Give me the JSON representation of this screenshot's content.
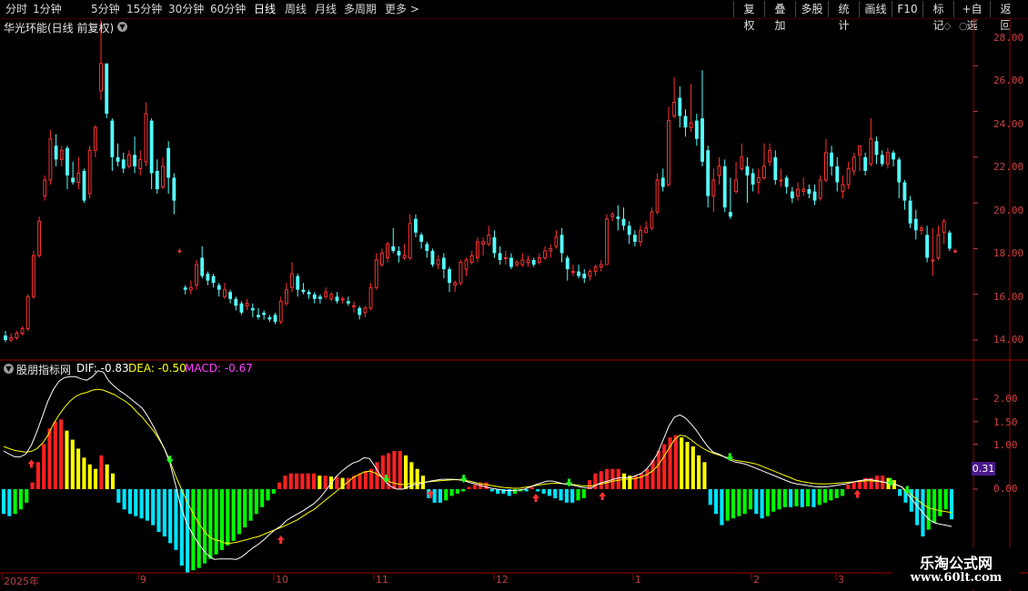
{
  "toolbar": {
    "periods": [
      "分时",
      "1分钟",
      "5分钟",
      "15分钟",
      "30分钟",
      "60分钟",
      "日线",
      "周线",
      "月线",
      "多周期",
      "更多 >"
    ],
    "active_period": "日线",
    "right_buttons": [
      "复权",
      "叠加",
      "多股",
      "统计",
      "画线",
      "F10",
      "标记",
      "+自选",
      "返回"
    ]
  },
  "price_panel": {
    "title": "华光环能(日线 前复权)",
    "y_ticks": [
      "28.00",
      "26.00",
      "24.00",
      "22.00",
      "20.00",
      "18.00",
      "16.00",
      "14.00"
    ]
  },
  "indicator_panel": {
    "name": "股朋指标网",
    "dif_text": "DIF: -0.83",
    "dea_text": "DEA: -0.50",
    "macd_text": "MACD: -0.67",
    "y_ticks": [
      "2.00",
      "1.50",
      "1.00",
      "0.00"
    ],
    "current_value": "0.31"
  },
  "x_axis": {
    "labels": [
      "2025年",
      "9",
      "10",
      "11",
      "12",
      "1",
      "2",
      "3"
    ]
  },
  "watermark": {
    "line1": "乐淘公式网",
    "line2": "www.60lt.com"
  },
  "colors": {
    "up": "#ff3232",
    "down": "#54ffff",
    "dif": "#ffffff",
    "dea": "#ffff00",
    "macd_label": "#ff00ff",
    "hist_red": "#ff2020",
    "hist_yellow": "#ffff00",
    "hist_cyan": "#00e5ff",
    "hist_green": "#00ff00",
    "grid_red": "#8b0000"
  },
  "chart_data": {
    "type": "candlestick",
    "price_ylim": [
      13.0,
      29.0
    ],
    "candles": [
      [
        14.2,
        14.0,
        14.4,
        13.9
      ],
      [
        14.0,
        14.1,
        14.3,
        13.9
      ],
      [
        14.1,
        14.3,
        14.4,
        14.0
      ],
      [
        14.3,
        14.5,
        14.6,
        14.2
      ],
      [
        14.5,
        15.9,
        16.0,
        14.4
      ],
      [
        15.9,
        17.7,
        17.9,
        15.8
      ],
      [
        17.7,
        19.2,
        19.4,
        17.6
      ],
      [
        20.3,
        21.0,
        21.2,
        20.1
      ],
      [
        21.0,
        22.8,
        23.2,
        20.8
      ],
      [
        22.5,
        21.9,
        23.0,
        21.6
      ],
      [
        21.9,
        22.3,
        22.5,
        21.6
      ],
      [
        22.4,
        21.2,
        22.5,
        20.6
      ],
      [
        21.1,
        20.9,
        21.8,
        20.8
      ],
      [
        20.9,
        21.3,
        22.0,
        20.6
      ],
      [
        21.4,
        20.1,
        21.5,
        20.0
      ],
      [
        20.4,
        22.3,
        22.5,
        20.2
      ],
      [
        22.3,
        23.3,
        23.4,
        22.0
      ],
      [
        24.9,
        26.1,
        28.0,
        24.5
      ],
      [
        26.1,
        23.9,
        26.1,
        23.7
      ],
      [
        23.6,
        22.0,
        23.7,
        21.4
      ],
      [
        22.0,
        21.8,
        22.6,
        21.6
      ],
      [
        21.9,
        21.5,
        22.2,
        21.3
      ],
      [
        21.6,
        22.1,
        22.3,
        21.5
      ],
      [
        22.1,
        21.6,
        22.9,
        21.3
      ],
      [
        21.5,
        21.9,
        22.3,
        21.2
      ],
      [
        21.8,
        23.9,
        24.4,
        21.6
      ],
      [
        23.6,
        21.3,
        23.7,
        20.6
      ],
      [
        21.4,
        20.6,
        21.9,
        20.4
      ],
      [
        20.7,
        21.6,
        22.0,
        20.6
      ],
      [
        22.4,
        21.1,
        22.7,
        20.4
      ],
      [
        21.1,
        20.1,
        21.3,
        19.5
      ],
      [
        17.9,
        17.9,
        18.0,
        17.8
      ],
      [
        16.3,
        16.2,
        16.4,
        16.0
      ],
      [
        16.2,
        16.3,
        16.6,
        16.0
      ],
      [
        16.4,
        17.3,
        17.5,
        16.2
      ],
      [
        17.6,
        16.8,
        18.1,
        16.7
      ],
      [
        16.9,
        16.6,
        17.0,
        16.4
      ],
      [
        16.8,
        16.5,
        16.9,
        16.3
      ],
      [
        16.4,
        16.2,
        16.5,
        15.9
      ],
      [
        15.9,
        16.2,
        16.5,
        15.8
      ],
      [
        16.1,
        15.8,
        16.2,
        15.6
      ],
      [
        15.8,
        15.5,
        15.9,
        15.3
      ],
      [
        15.6,
        15.2,
        15.7,
        15.1
      ],
      [
        15.5,
        15.6,
        15.8,
        15.3
      ],
      [
        15.4,
        15.3,
        15.6,
        15.0
      ],
      [
        15.1,
        15.0,
        15.4,
        14.9
      ],
      [
        15.2,
        15.1,
        15.3,
        14.9
      ],
      [
        15.0,
        14.9,
        15.1,
        14.8
      ],
      [
        15.1,
        14.8,
        15.2,
        14.7
      ],
      [
        14.8,
        15.7,
        15.9,
        14.7
      ],
      [
        15.6,
        16.2,
        16.5,
        15.5
      ],
      [
        16.3,
        16.9,
        17.4,
        16.1
      ],
      [
        16.8,
        16.2,
        16.9,
        15.9
      ],
      [
        16.2,
        16.1,
        16.5,
        16.0
      ],
      [
        16.1,
        16.0,
        16.2,
        15.8
      ],
      [
        16.0,
        15.8,
        16.1,
        15.6
      ],
      [
        15.9,
        15.8,
        16.0,
        15.6
      ],
      [
        15.9,
        16.1,
        16.3,
        15.8
      ],
      [
        15.8,
        16.0,
        16.1,
        15.7
      ],
      [
        15.9,
        15.7,
        16.1,
        15.6
      ],
      [
        15.8,
        15.8,
        15.9,
        15.6
      ],
      [
        15.7,
        15.6,
        15.9,
        15.5
      ],
      [
        15.5,
        15.5,
        15.7,
        15.2
      ],
      [
        15.4,
        15.1,
        15.5,
        14.9
      ],
      [
        15.2,
        15.4,
        15.5,
        15.0
      ],
      [
        15.4,
        16.3,
        16.5,
        15.3
      ],
      [
        16.3,
        17.5,
        17.8,
        16.2
      ],
      [
        17.3,
        17.8,
        18.0,
        17.2
      ],
      [
        17.6,
        18.2,
        18.3,
        17.4
      ],
      [
        18.1,
        17.9,
        18.9,
        17.8
      ],
      [
        17.9,
        17.7,
        18.1,
        17.4
      ],
      [
        17.6,
        17.7,
        18.2,
        17.5
      ],
      [
        17.6,
        19.1,
        19.5,
        17.5
      ],
      [
        19.3,
        18.7,
        19.5,
        18.5
      ],
      [
        18.6,
        18.3,
        18.7,
        18.0
      ],
      [
        18.2,
        17.9,
        18.3,
        17.6
      ],
      [
        17.9,
        17.3,
        18.0,
        17.2
      ],
      [
        17.3,
        17.5,
        17.7,
        17.1
      ],
      [
        17.6,
        17.1,
        17.8,
        16.7
      ],
      [
        17.1,
        16.5,
        17.2,
        16.1
      ],
      [
        16.4,
        16.5,
        16.6,
        16.1
      ],
      [
        16.5,
        17.4,
        17.5,
        16.4
      ],
      [
        17.1,
        17.5,
        17.6,
        16.8
      ],
      [
        17.4,
        17.7,
        17.9,
        17.3
      ],
      [
        17.6,
        18.3,
        18.5,
        17.4
      ],
      [
        18.2,
        18.3,
        18.5,
        17.7
      ],
      [
        18.2,
        18.6,
        19.0,
        18.1
      ],
      [
        18.5,
        17.8,
        18.8,
        17.6
      ],
      [
        17.8,
        17.5,
        18.1,
        17.3
      ],
      [
        17.6,
        17.6,
        17.9,
        17.3
      ],
      [
        17.6,
        17.2,
        17.8,
        17.1
      ],
      [
        17.3,
        17.4,
        17.5,
        17.2
      ],
      [
        17.3,
        17.5,
        17.8,
        17.2
      ],
      [
        17.4,
        17.5,
        17.7,
        17.2
      ],
      [
        17.5,
        17.3,
        17.6,
        17.2
      ],
      [
        17.4,
        17.6,
        17.8,
        17.3
      ],
      [
        17.6,
        17.9,
        18.1,
        17.5
      ],
      [
        17.9,
        18.0,
        18.2,
        17.6
      ],
      [
        18.1,
        18.5,
        18.8,
        18.0
      ],
      [
        18.6,
        17.8,
        18.9,
        17.4
      ],
      [
        17.6,
        17.1,
        17.7,
        16.6
      ],
      [
        17.0,
        17.0,
        17.3,
        16.8
      ],
      [
        17.0,
        16.8,
        17.3,
        16.7
      ],
      [
        16.9,
        16.7,
        17.1,
        16.5
      ],
      [
        16.8,
        17.0,
        17.1,
        16.6
      ],
      [
        17.0,
        17.2,
        17.3,
        16.8
      ],
      [
        17.2,
        17.3,
        17.5,
        17.0
      ],
      [
        17.3,
        19.3,
        19.5,
        17.3
      ],
      [
        19.4,
        19.5,
        19.6,
        19.2
      ],
      [
        19.4,
        19.3,
        19.9,
        18.8
      ],
      [
        19.3,
        19.0,
        19.8,
        18.8
      ],
      [
        19.0,
        18.6,
        19.2,
        18.2
      ],
      [
        18.6,
        18.3,
        18.8,
        18.1
      ],
      [
        18.3,
        18.8,
        19.0,
        18.1
      ],
      [
        18.7,
        18.9,
        19.2,
        18.7
      ],
      [
        18.9,
        19.6,
        19.8,
        18.8
      ],
      [
        19.6,
        21.0,
        21.3,
        19.5
      ],
      [
        21.1,
        20.7,
        21.5,
        20.5
      ],
      [
        20.8,
        23.6,
        24.2,
        20.7
      ],
      [
        23.8,
        24.4,
        25.5,
        23.7
      ],
      [
        24.6,
        23.8,
        25.1,
        23.3
      ],
      [
        23.8,
        23.3,
        24.1,
        22.9
      ],
      [
        23.3,
        23.5,
        25.2,
        23.1
      ],
      [
        23.6,
        22.8,
        23.9,
        22.5
      ],
      [
        23.7,
        21.8,
        25.8,
        21.6
      ],
      [
        22.3,
        20.3,
        22.5,
        19.8
      ],
      [
        20.3,
        21.0,
        21.5,
        19.6
      ],
      [
        21.2,
        21.6,
        22.0,
        20.8
      ],
      [
        21.6,
        19.8,
        21.9,
        19.6
      ],
      [
        19.6,
        19.4,
        21.1,
        19.3
      ],
      [
        20.5,
        21.0,
        21.8,
        20.4
      ],
      [
        21.5,
        22.0,
        22.6,
        21.4
      ],
      [
        21.6,
        21.2,
        22.0,
        20.0
      ],
      [
        21.3,
        20.8,
        21.5,
        20.5
      ],
      [
        20.9,
        21.1,
        21.5,
        20.4
      ],
      [
        21.1,
        21.6,
        22.6,
        21.0
      ],
      [
        21.8,
        22.3,
        22.6,
        21.6
      ],
      [
        22.0,
        21.0,
        22.3,
        20.8
      ],
      [
        21.0,
        21.0,
        21.5,
        20.7
      ],
      [
        21.1,
        20.7,
        21.2,
        20.4
      ],
      [
        20.5,
        20.2,
        20.7,
        20.0
      ],
      [
        20.3,
        20.6,
        20.9,
        20.1
      ],
      [
        20.5,
        20.6,
        21.1,
        20.3
      ],
      [
        20.6,
        20.4,
        20.8,
        20.2
      ],
      [
        20.5,
        20.1,
        20.8,
        19.9
      ],
      [
        20.2,
        21.0,
        21.2,
        20.1
      ],
      [
        21.0,
        22.2,
        22.8,
        20.9
      ],
      [
        22.2,
        21.6,
        22.5,
        21.2
      ],
      [
        21.6,
        20.9,
        22.0,
        20.5
      ],
      [
        20.5,
        20.8,
        21.2,
        20.2
      ],
      [
        20.8,
        21.5,
        21.8,
        20.6
      ],
      [
        21.4,
        22.0,
        22.2,
        21.2
      ],
      [
        22.1,
        22.5,
        22.5,
        21.4
      ],
      [
        22.0,
        21.4,
        22.2,
        21.2
      ],
      [
        21.7,
        22.8,
        23.7,
        21.6
      ],
      [
        22.7,
        22.1,
        22.9,
        21.7
      ],
      [
        22.1,
        21.7,
        22.3,
        21.6
      ],
      [
        21.7,
        22.2,
        22.4,
        21.5
      ],
      [
        22.2,
        21.9,
        22.3,
        21.6
      ],
      [
        21.9,
        20.9,
        22.0,
        20.2
      ],
      [
        20.9,
        20.1,
        21.0,
        19.7
      ],
      [
        20.1,
        19.1,
        20.3,
        18.9
      ],
      [
        19.3,
        18.8,
        19.7,
        18.4
      ],
      [
        18.8,
        18.9,
        19.0,
        18.6
      ],
      [
        18.6,
        17.6,
        19.0,
        17.4
      ],
      [
        17.5,
        17.5,
        18.9,
        16.8
      ],
      [
        17.6,
        18.6,
        19.0,
        17.5
      ],
      [
        18.7,
        19.2,
        19.3,
        18.2
      ],
      [
        18.7,
        18.0,
        18.8,
        17.9
      ],
      [
        17.9,
        17.9,
        18.0,
        17.8
      ]
    ],
    "dif": [
      0.85,
      0.78,
      0.72,
      0.72,
      0.78,
      0.98,
      1.28,
      1.62,
      1.96,
      2.22,
      2.4,
      2.48,
      2.5,
      2.5,
      2.45,
      2.42,
      2.5,
      2.63,
      2.6,
      2.4,
      2.28,
      2.18,
      2.1,
      2.0,
      1.9,
      1.8,
      1.62,
      1.4,
      1.15,
      0.9,
      0.58,
      0.1,
      -0.4,
      -0.75,
      -0.98,
      -1.18,
      -1.35,
      -1.48,
      -1.56,
      -1.55,
      -1.55,
      -1.55,
      -1.56,
      -1.5,
      -1.4,
      -1.3,
      -1.22,
      -1.12,
      -1.0,
      -0.9,
      -0.82,
      -0.7,
      -0.62,
      -0.55,
      -0.48,
      -0.4,
      -0.32,
      -0.2,
      -0.05,
      0.12,
      0.28,
      0.4,
      0.5,
      0.58,
      0.62,
      0.7,
      0.68,
      0.5,
      0.3,
      0.15,
      0.05,
      0.0,
      0.0,
      0.05,
      0.1,
      0.12,
      0.15,
      0.18,
      0.2,
      0.22,
      0.22,
      0.22,
      0.21,
      0.19,
      0.15,
      0.12,
      0.08,
      0.05,
      0.02,
      0.0,
      -0.02,
      -0.03,
      -0.03,
      -0.02,
      0.0,
      0.05,
      0.1,
      0.14,
      0.18,
      0.18,
      0.15,
      0.12,
      0.1,
      0.08,
      0.05,
      0.03,
      0.02,
      0.1,
      0.15,
      0.18,
      0.22,
      0.25,
      0.26,
      0.25,
      0.3,
      0.35,
      0.45,
      0.6,
      0.8,
      1.1,
      1.4,
      1.6,
      1.65,
      1.58,
      1.45,
      1.3,
      1.12,
      0.95,
      0.82,
      0.78,
      0.72,
      0.65,
      0.6,
      0.58,
      0.55,
      0.5,
      0.45,
      0.4,
      0.35,
      0.3,
      0.25,
      0.2,
      0.15,
      0.12,
      0.1,
      0.08,
      0.06,
      0.05,
      0.05,
      0.06,
      0.08,
      0.1,
      0.12,
      0.15,
      0.18,
      0.2,
      0.22,
      0.2,
      0.18,
      0.15,
      0.12,
      0.1,
      0.05,
      -0.1,
      -0.25,
      -0.4,
      -0.55,
      -0.68,
      -0.75,
      -0.78,
      -0.8,
      -0.83
    ],
    "dea": [
      0.95,
      0.9,
      0.86,
      0.84,
      0.82,
      0.84,
      0.9,
      1.02,
      1.2,
      1.45,
      1.65,
      1.82,
      1.96,
      2.06,
      2.12,
      2.15,
      2.2,
      2.22,
      2.2,
      2.15,
      2.1,
      2.02,
      1.95,
      1.85,
      1.72,
      1.6,
      1.45,
      1.3,
      1.12,
      0.9,
      0.62,
      0.3,
      0.02,
      -0.25,
      -0.5,
      -0.72,
      -0.9,
      -1.05,
      -1.12,
      -1.15,
      -1.2,
      -1.2,
      -1.18,
      -1.15,
      -1.12,
      -1.08,
      -1.05,
      -1.0,
      -0.95,
      -0.9,
      -0.85,
      -0.8,
      -0.74,
      -0.68,
      -0.6,
      -0.52,
      -0.45,
      -0.35,
      -0.25,
      -0.15,
      -0.05,
      0.05,
      0.15,
      0.25,
      0.32,
      0.38,
      0.4,
      0.36,
      0.28,
      0.2,
      0.15,
      0.12,
      0.1,
      0.12,
      0.14,
      0.15,
      0.16,
      0.17,
      0.18,
      0.19,
      0.2,
      0.21,
      0.21,
      0.2,
      0.18,
      0.15,
      0.12,
      0.1,
      0.08,
      0.06,
      0.04,
      0.03,
      0.02,
      0.02,
      0.04,
      0.06,
      0.08,
      0.1,
      0.12,
      0.13,
      0.13,
      0.12,
      0.11,
      0.1,
      0.08,
      0.07,
      0.07,
      0.1,
      0.12,
      0.15,
      0.18,
      0.2,
      0.22,
      0.22,
      0.24,
      0.27,
      0.32,
      0.4,
      0.52,
      0.7,
      0.9,
      1.1,
      1.2,
      1.18,
      1.1,
      1.0,
      0.92,
      0.85,
      0.8,
      0.76,
      0.72,
      0.68,
      0.64,
      0.62,
      0.6,
      0.58,
      0.55,
      0.5,
      0.45,
      0.4,
      0.35,
      0.3,
      0.25,
      0.2,
      0.17,
      0.15,
      0.13,
      0.12,
      0.12,
      0.12,
      0.13,
      0.14,
      0.15,
      0.16,
      0.17,
      0.18,
      0.19,
      0.18,
      0.17,
      0.15,
      0.13,
      0.1,
      0.05,
      -0.05,
      -0.15,
      -0.25,
      -0.35,
      -0.42,
      -0.45,
      -0.48,
      -0.5,
      -0.52
    ],
    "macd_hist": [
      -0.55,
      -0.6,
      -0.55,
      -0.45,
      -0.3,
      0.15,
      0.6,
      1.0,
      1.35,
      1.5,
      1.55,
      1.3,
      1.1,
      0.9,
      0.7,
      0.55,
      0.45,
      0.75,
      0.55,
      0.35,
      -0.3,
      -0.45,
      -0.55,
      -0.6,
      -0.65,
      -0.7,
      -0.8,
      -0.95,
      -1.05,
      -1.2,
      -1.35,
      -1.7,
      -1.85,
      -1.8,
      -1.75,
      -1.65,
      -1.55,
      -1.45,
      -1.35,
      -1.25,
      -1.15,
      -1.0,
      -0.85,
      -0.7,
      -0.55,
      -0.4,
      -0.25,
      -0.1,
      0.15,
      0.3,
      0.35,
      0.35,
      0.35,
      0.35,
      0.35,
      0.3,
      0.3,
      0.28,
      0.28,
      0.25,
      0.25,
      0.3,
      0.35,
      0.4,
      0.45,
      0.6,
      0.75,
      0.8,
      0.85,
      0.85,
      0.75,
      0.6,
      0.45,
      0.3,
      -0.2,
      -0.3,
      -0.3,
      -0.25,
      -0.15,
      -0.1,
      -0.05,
      0.05,
      0.1,
      0.15,
      0.15,
      -0.05,
      -0.1,
      -0.1,
      -0.15,
      -0.1,
      -0.05,
      -0.05,
      0.05,
      -0.05,
      -0.1,
      -0.15,
      -0.2,
      -0.25,
      -0.3,
      -0.3,
      -0.25,
      -0.2,
      0.2,
      0.35,
      0.4,
      0.45,
      0.45,
      0.45,
      0.35,
      0.3,
      0.3,
      0.35,
      0.45,
      0.65,
      0.85,
      1.0,
      1.15,
      1.2,
      1.15,
      1.05,
      0.95,
      0.75,
      0.6,
      -0.35,
      -0.55,
      -0.8,
      -0.7,
      -0.65,
      -0.6,
      -0.55,
      -0.45,
      -0.55,
      -0.65,
      -0.6,
      -0.5,
      -0.45,
      -0.4,
      -0.4,
      -0.38,
      -0.4,
      -0.38,
      -0.4,
      -0.35,
      -0.3,
      -0.25,
      -0.2,
      -0.15,
      0.1,
      0.15,
      0.2,
      0.25,
      0.25,
      0.3,
      0.3,
      0.25,
      0.2,
      -0.15,
      -0.3,
      -0.5,
      -0.8,
      -1.05,
      -0.9,
      -0.75,
      -0.6,
      -0.45,
      -0.67
    ],
    "indicator_ylim": [
      -1.9,
      2.8
    ]
  }
}
